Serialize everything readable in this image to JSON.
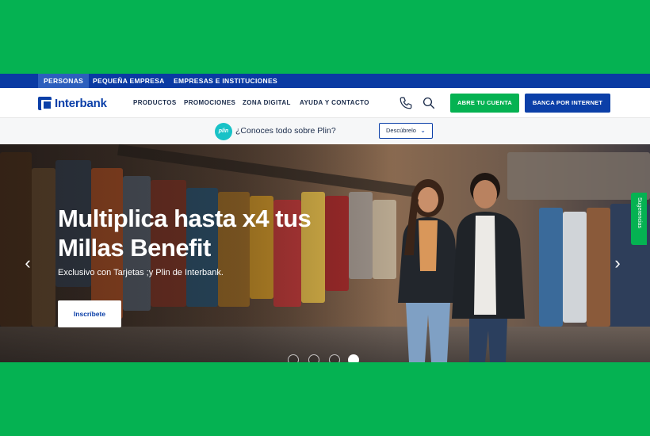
{
  "segments": [
    {
      "label": "PERSONAS",
      "active": true
    },
    {
      "label": "PEQUEÑA EMPRESA",
      "active": false
    },
    {
      "label": "EMPRESAS E INSTITUCIONES",
      "active": false
    }
  ],
  "brand": {
    "name": "Interbank",
    "color": "#0b3fa8"
  },
  "nav": {
    "links": [
      "PRODUCTOS",
      "PROMOCIONES",
      "ZONA DIGITAL",
      "AYUDA Y CONTACTO"
    ],
    "icons": [
      "phone-icon",
      "search-icon"
    ],
    "open_account_label": "ABRE TU CUENTA",
    "internet_banking_label": "BANCA POR INTERNET"
  },
  "plin": {
    "logo_text": "plin",
    "question": "¿Conoces todo sobre Plin?",
    "button_label": "Descúbrelo",
    "button_icon": "chevron-down-icon"
  },
  "hero": {
    "title": "Multiplica hasta x4 tus Millas Benefit",
    "subtitle": "Exclusivo con Tarjetas ;y Plin de Interbank.",
    "cta_label": "Inscríbete",
    "prev_icon": "chevron-left-icon",
    "next_icon": "chevron-right-icon",
    "slides": 4
  },
  "feedback_tab": {
    "label": "Sugerencias"
  },
  "colors": {
    "accent_green": "#05b252",
    "brand_blue": "#0b3fa8",
    "segment_bar": "#0a3aa3"
  }
}
